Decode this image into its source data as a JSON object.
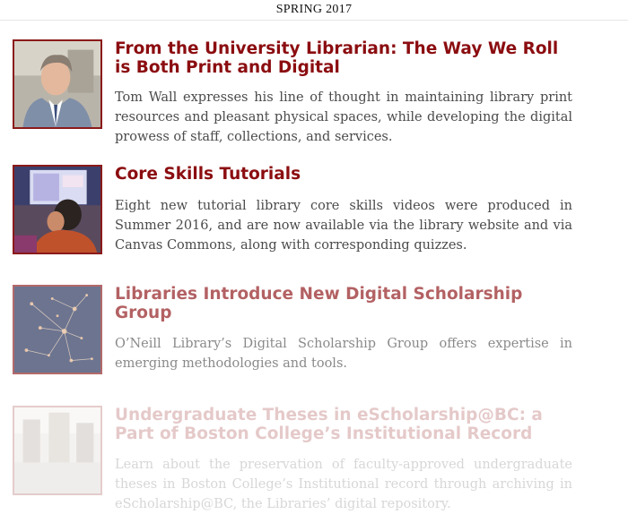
{
  "header": {
    "issue": "SPRING 2017"
  },
  "articles": [
    {
      "title": "From the University Librarian: The Way We Roll is Both Print and Digital",
      "description": "Tom Wall expresses his line of thought in maintaining library print resources and pleasant physical spaces, while developing the digital prowess of staff, collections, and services.",
      "image_icon": "portrait-photo"
    },
    {
      "title": "Core Skills Tutorials",
      "description": "Eight new tutorial library core skills videos were produced in Summer 2016, and are now available via the library website and via Canvas Commons, along with corresponding quizzes.",
      "image_icon": "students-at-screen-photo"
    },
    {
      "title": "Libraries Introduce New Digital Scholarship Group",
      "description": "O’Neill Library’s Digital Scholarship Group offers expertise in emerging methodologies and tools.",
      "image_icon": "network-visualization-photo"
    },
    {
      "title": "Undergraduate Theses in eScholarship@BC: a Part of Boston College’s Institutional Record",
      "description": "Learn about the preservation of faculty-approved undergraduate theses in Boston College’s Institutional record through archiving in eScholarship@BC, the Libraries’ digital repository.",
      "image_icon": "campus-building-photo"
    }
  ],
  "colors": {
    "title": "#8b0d10",
    "text": "#4b4b4b",
    "thumb_border": "#8b1a1a"
  }
}
